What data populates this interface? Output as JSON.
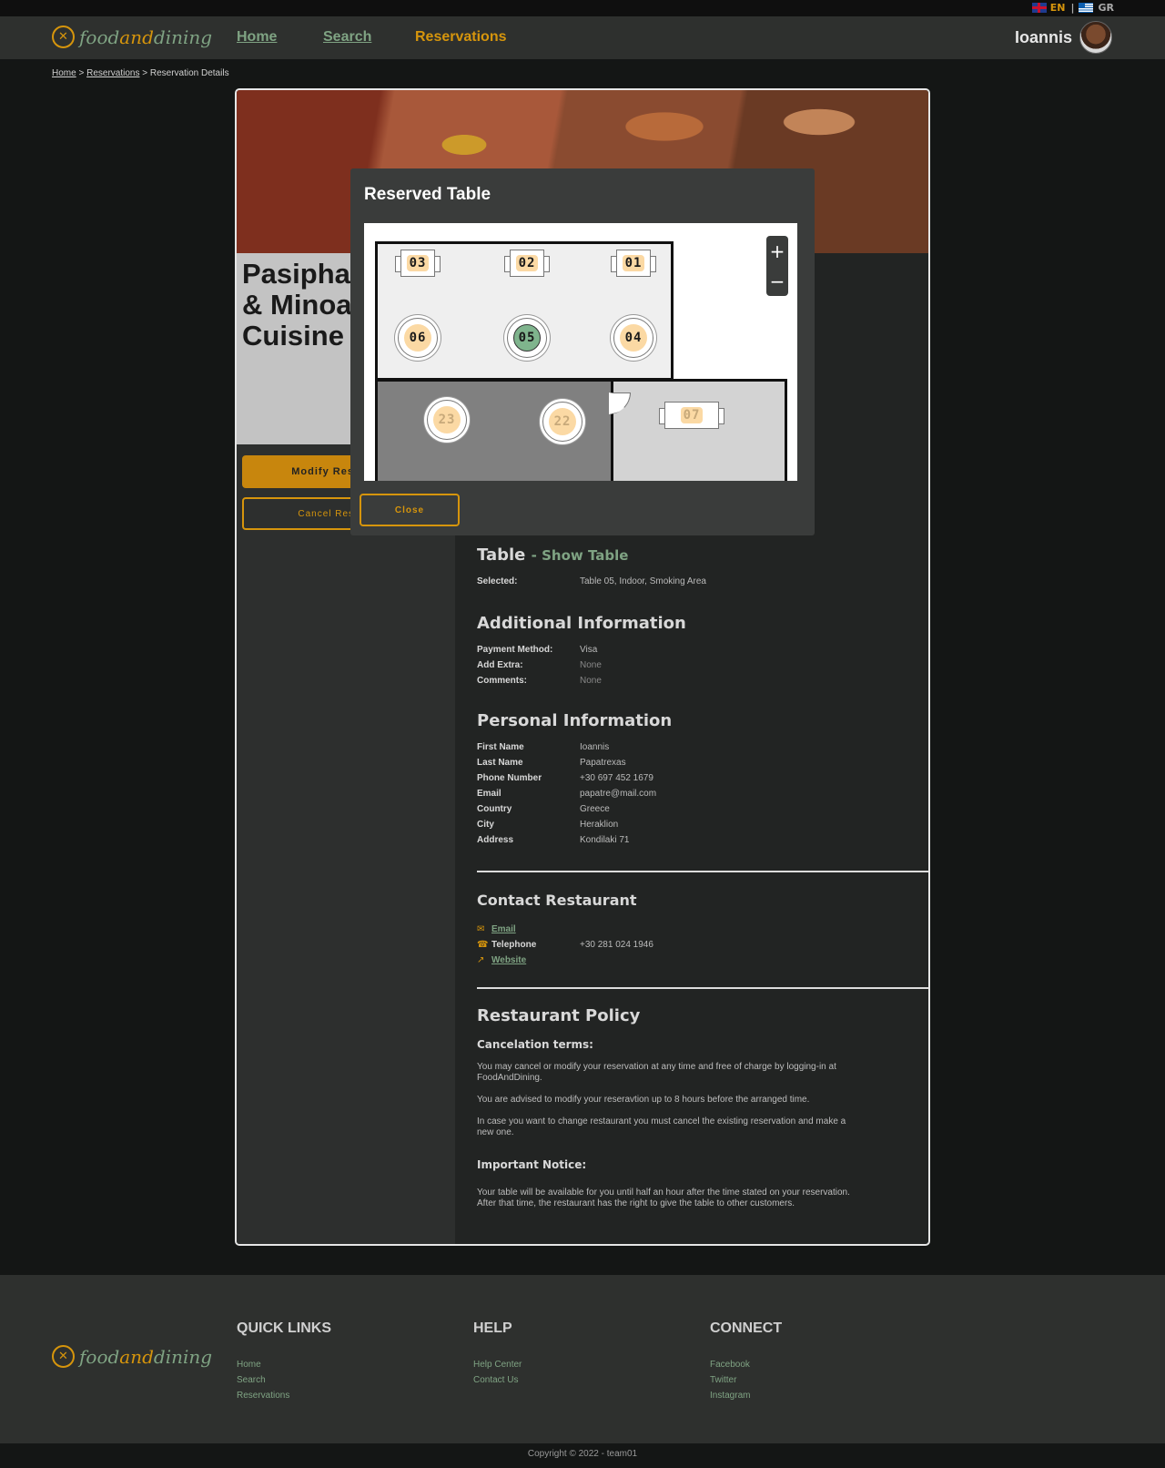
{
  "lang": {
    "en": "EN",
    "separator": "|",
    "gr": "GR"
  },
  "brand": {
    "logo_mark": "✕",
    "part1": "food",
    "part2": "and",
    "part3": "dining"
  },
  "nav": {
    "home": "Home",
    "search": "Search",
    "reservations": "Reservations"
  },
  "user": {
    "name": "Ioannis"
  },
  "breadcrumb": {
    "home": "Home",
    "sep1": " > ",
    "reservations": "Reservations",
    "sep2": " > ",
    "current": "Reservation Details"
  },
  "restaurant": {
    "name": "Pasiphae\n& Minoan\nCuisine"
  },
  "actions": {
    "modify": "Modify Reservation",
    "cancel": "Cancel Reservation"
  },
  "modal": {
    "title": "Reserved Table",
    "close": "Close",
    "zoom_in": "+",
    "zoom_out": "−",
    "tables": {
      "t03": "03",
      "t02": "02",
      "t01": "01",
      "t06": "06",
      "t05": "05",
      "t04": "04",
      "t23": "23",
      "t22": "22",
      "t07": "07"
    }
  },
  "table_section": {
    "title": "Table",
    "show_link": "- Show Table",
    "selected_label": "Selected:",
    "selected_value": "Table 05, Indoor, Smoking Area"
  },
  "additional": {
    "title": "Additional Information",
    "payment_label": "Payment Method:",
    "payment_value": "Visa",
    "extra_label": "Add Extra:",
    "extra_value": "None",
    "comments_label": "Comments:",
    "comments_value": "None"
  },
  "personal": {
    "title": "Personal Information",
    "first_label": "First Name",
    "first_value": "Ioannis",
    "last_label": "Last Name",
    "last_value": "Papatrexas",
    "phone_label": "Phone Number",
    "phone_value": "+30 697 452 1679",
    "email_label": "Email",
    "email_value": "papatre@mail.com",
    "country_label": "Country",
    "country_value": "Greece",
    "city_label": "City",
    "city_value": "Heraklion",
    "address_label": "Address",
    "address_value": "Kondilaki 71"
  },
  "contact": {
    "title": "Contact Restaurant",
    "email": "Email",
    "telephone_label": "Telephone",
    "telephone_value": "+30 281 024 1946",
    "website": "Website"
  },
  "policy": {
    "title": "Restaurant Policy",
    "cancel_title": "Cancelation terms:",
    "p1": "You may cancel or modify your reservation at any time and free of charge by logging-in at FoodAndDining.",
    "p2": "You are advised to modify your reseravtion up to 8 hours before the arranged time.",
    "p3": "In case you want to change restaurant you must cancel the existing reservation and make a new one.",
    "notice_title": "Important Notice:",
    "p4": "Your table will be available for you until half an hour after the time stated on your reservation. After that time, the restaurant has the right to give the table to other customers."
  },
  "footer": {
    "quick_title": "QUICK LINKS",
    "quick": [
      "Home",
      "Search",
      "Reservations"
    ],
    "help_title": "HELP",
    "help": [
      "Help Center",
      "Contact Us"
    ],
    "connect_title": "CONNECT",
    "connect": [
      "Facebook",
      "Twitter",
      "Instagram"
    ],
    "copyright": "Copyright © 2022 - team01"
  },
  "colors": {
    "accent": "#d6950c",
    "green": "#7fa383",
    "selected_table": "#7fb48d",
    "table_label": "#fbd9a4"
  }
}
